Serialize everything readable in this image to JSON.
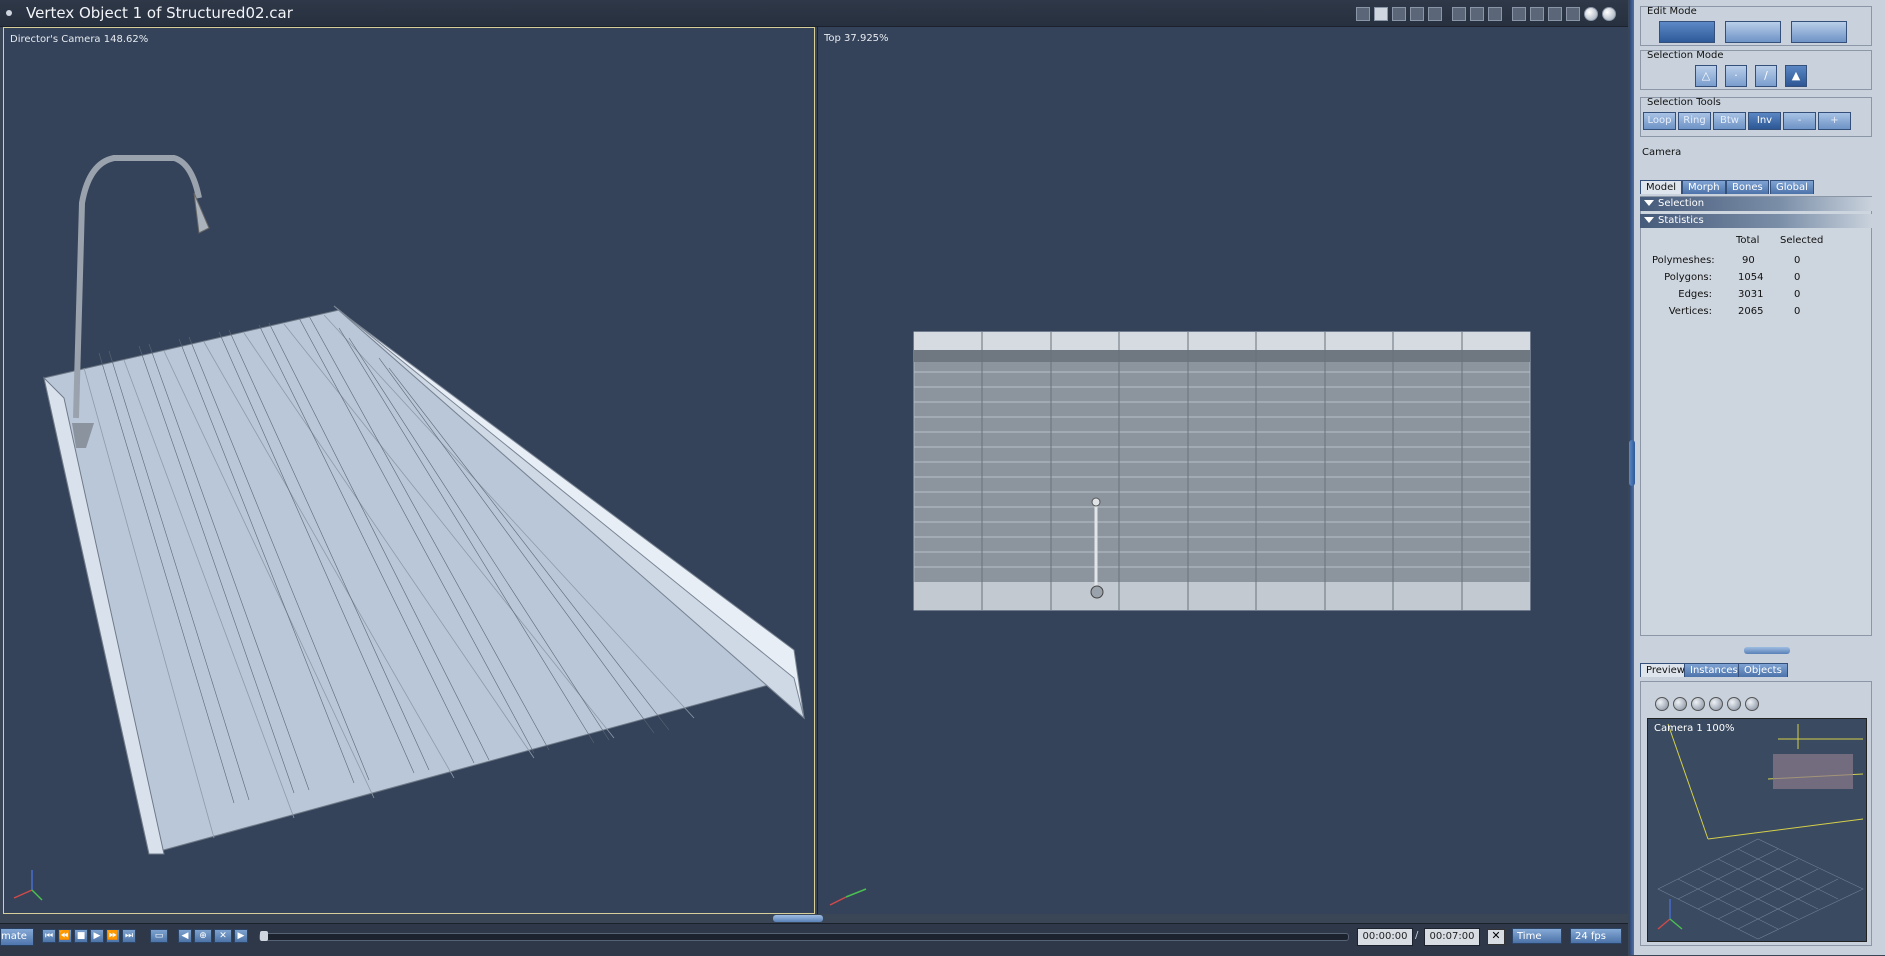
{
  "window": {
    "title": "Vertex Object 1 of Structured02.car"
  },
  "viewports": {
    "left_label": "Director's Camera 148.62%",
    "right_label": "Top 37.925%"
  },
  "timeline": {
    "mode_tab": "mate",
    "current_time": "00:00:00",
    "separator": "/",
    "end_time": "00:07:00",
    "time_mode": "Time",
    "fps": "24 fps"
  },
  "panel": {
    "edit_mode_title": "Edit Mode",
    "selection_mode_title": "Selection Mode",
    "selection_tools_title": "Selection Tools",
    "selection_tools": [
      "Loop",
      "Ring",
      "Btw",
      "Inv",
      "-",
      "+"
    ],
    "camera_label": "Camera",
    "tabs": [
      "Model",
      "Morph",
      "Bones",
      "Global"
    ],
    "sections": {
      "selection": "Selection",
      "statistics": "Statistics"
    },
    "stats": {
      "headers": [
        "Total",
        "Selected"
      ],
      "rows": [
        {
          "label": "Polymeshes:",
          "total": "90",
          "selected": "0"
        },
        {
          "label": "Polygons:",
          "total": "1054",
          "selected": "0"
        },
        {
          "label": "Edges:",
          "total": "3031",
          "selected": "0"
        },
        {
          "label": "Vertices:",
          "total": "2065",
          "selected": "0"
        }
      ]
    },
    "bottom_tabs": [
      "Preview",
      "Instances",
      "Objects"
    ],
    "preview_label": "Camera 1 100%"
  },
  "icons": {
    "view_layouts": [
      "single-view-icon",
      "two-view-icon",
      "three-view-icon",
      "four-view-icon",
      "custom-view-icon"
    ],
    "render_modes": [
      "wireframe-icon",
      "hidden-line-icon",
      "flat-shaded-icon",
      "smooth-icon",
      "texture-icon"
    ]
  }
}
